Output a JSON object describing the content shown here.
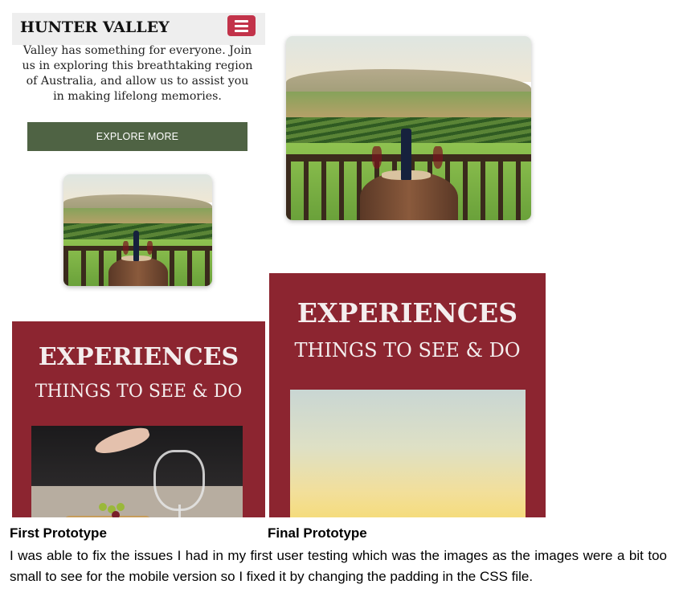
{
  "first_prototype": {
    "header": {
      "brand": "HUNTER VALLEY",
      "menu_icon": "hamburger-menu-icon"
    },
    "intro_text": "Valley has something for everyone. Join us in exploring this breathtaking region of Australia, and allow us to assist you in making lifelong memories.",
    "explore_button": "EXPLORE MORE",
    "experiences": {
      "title": "EXPERIENCES",
      "subtitle": "THINGS TO SEE & DO"
    }
  },
  "final_prototype": {
    "experiences": {
      "title": "EXPERIENCES",
      "subtitle": "THINGS TO SEE & DO"
    }
  },
  "captions": {
    "first": "First Prototype",
    "final": "Final Prototype"
  },
  "description": "I was able to fix the issues I had in my first user testing which was the images as the images were a bit too small to see for the mobile version so I fixed it by changing the padding in the CSS file.",
  "colors": {
    "accent_red": "#8c2530",
    "menu_red": "#c2334a",
    "button_green": "#4f6344"
  }
}
